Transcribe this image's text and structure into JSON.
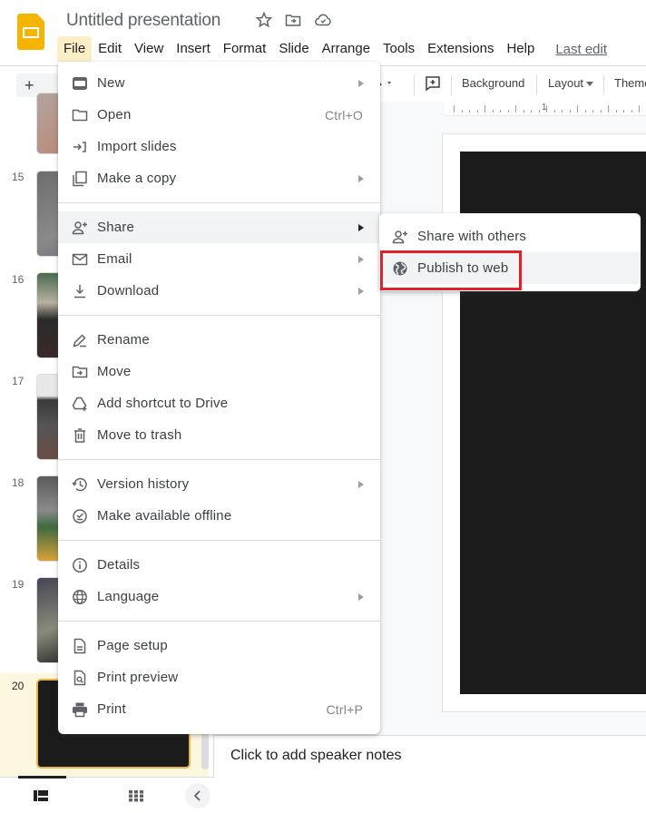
{
  "header": {
    "title": "Untitled presentation",
    "icons": [
      "star-icon",
      "move-folder-icon",
      "cloud-saved-icon"
    ],
    "menubar": [
      "File",
      "Edit",
      "View",
      "Insert",
      "Format",
      "Slide",
      "Arrange",
      "Tools",
      "Extensions",
      "Help"
    ],
    "last_edit": "Last edit"
  },
  "toolbar": {
    "new_slide": "+",
    "background": "Background",
    "layout": "Layout",
    "theme": "Theme"
  },
  "ruler": {
    "label": "1"
  },
  "filmstrip": {
    "slides": [
      {
        "number": ""
      },
      {
        "number": "15"
      },
      {
        "number": "16"
      },
      {
        "number": "17"
      },
      {
        "number": "18"
      },
      {
        "number": "19"
      },
      {
        "number": "20",
        "selected": true
      }
    ]
  },
  "file_menu": {
    "groups": [
      [
        {
          "label": "New",
          "icon": "new-icon",
          "submenu": true
        },
        {
          "label": "Open",
          "icon": "folder-icon",
          "shortcut": "Ctrl+O"
        },
        {
          "label": "Import slides",
          "icon": "import-icon"
        },
        {
          "label": "Make a copy",
          "icon": "copy-icon",
          "submenu": true
        }
      ],
      [
        {
          "label": "Share",
          "icon": "person-add-icon",
          "submenu": true,
          "hovered": true
        },
        {
          "label": "Email",
          "icon": "mail-icon",
          "submenu": true
        },
        {
          "label": "Download",
          "icon": "download-icon",
          "submenu": true
        }
      ],
      [
        {
          "label": "Rename",
          "icon": "rename-icon"
        },
        {
          "label": "Move",
          "icon": "move-folder-icon"
        },
        {
          "label": "Add shortcut to Drive",
          "icon": "drive-shortcut-icon"
        },
        {
          "label": "Move to trash",
          "icon": "trash-icon"
        }
      ],
      [
        {
          "label": "Version history",
          "icon": "history-icon",
          "submenu": true
        },
        {
          "label": "Make available offline",
          "icon": "offline-icon"
        }
      ],
      [
        {
          "label": "Details",
          "icon": "info-icon"
        },
        {
          "label": "Language",
          "icon": "globe-icon",
          "submenu": true
        }
      ],
      [
        {
          "label": "Page setup",
          "icon": "page-icon"
        },
        {
          "label": "Print preview",
          "icon": "print-preview-icon"
        },
        {
          "label": "Print",
          "icon": "print-icon",
          "shortcut": "Ctrl+P"
        }
      ]
    ]
  },
  "share_submenu": {
    "items": [
      {
        "label": "Share with others",
        "icon": "person-add-icon"
      },
      {
        "label": "Publish to web",
        "icon": "globe-filled-icon",
        "hovered": true,
        "highlighted": true
      }
    ]
  },
  "notes": {
    "placeholder": "Click to add speaker notes"
  },
  "colors": {
    "highlight": "#e3202a",
    "logo": "#f4b400",
    "selected_slide_border": "#e8b34a"
  }
}
